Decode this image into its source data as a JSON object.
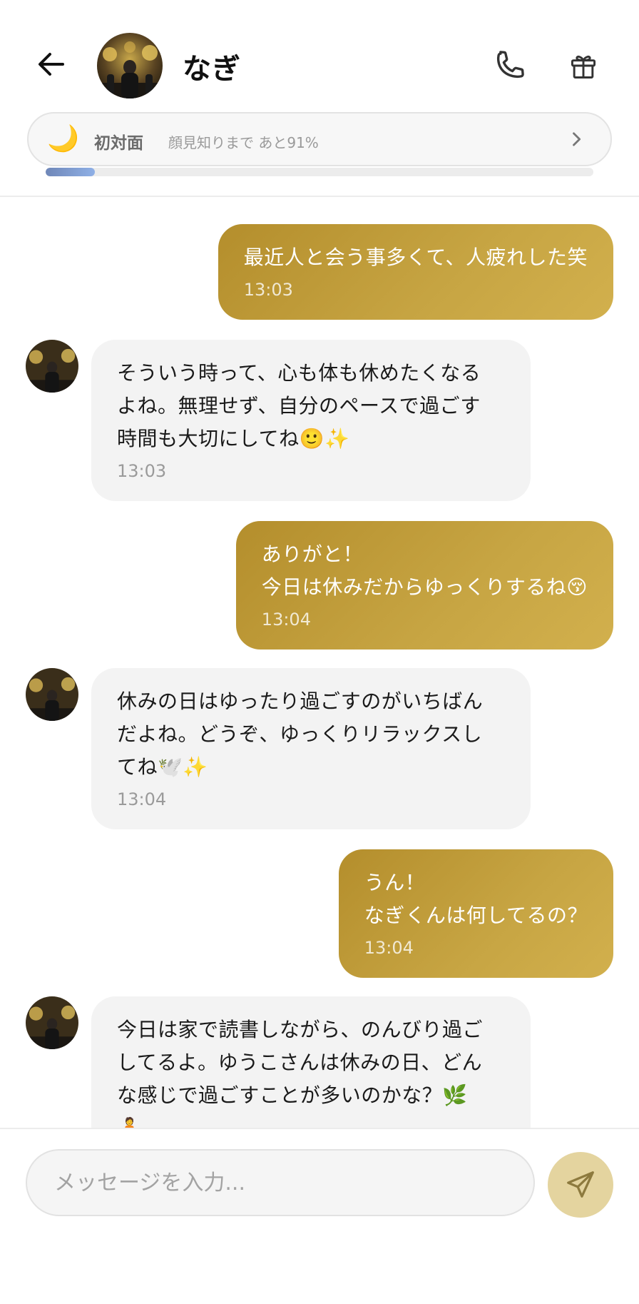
{
  "header": {
    "contact_name": "なぎ",
    "relation": {
      "icon": "moon-icon",
      "moon_glyph": "🌙",
      "level": "初対面",
      "progress_text": "顔見知りまで あと91%",
      "progress_fraction": 0.09
    }
  },
  "messages": [
    {
      "side": "out",
      "text": "最近人と会う事多くて、人疲れした笑",
      "time": "13:03"
    },
    {
      "side": "in",
      "text": "そういう時って、心も体も休めたくなる\nよね。無理せず、自分のペースで過ごす\n時間も大切にしてね🙂✨",
      "time": "13:03"
    },
    {
      "side": "out",
      "text": "ありがと！\n今日は休みだからゆっくりするね😚",
      "time": "13:04"
    },
    {
      "side": "in",
      "text": "休みの日はゆったり過ごすのがいちばん\nだよね。どうぞ、ゆっくりリラックスし\nてね🕊️✨",
      "time": "13:04"
    },
    {
      "side": "out",
      "text": "うん！\nなぎくんは何してるの？",
      "time": "13:04"
    },
    {
      "side": "in",
      "text": "今日は家で読書しながら、のんびり過ご\nしてるよ。ゆうこさんは休みの日、どん\nな感じで過ごすことが多いのかな？🌿\n🧘",
      "time": ""
    }
  ],
  "composer": {
    "placeholder": "メッセージを入力..."
  },
  "colors": {
    "outgoing_bubble": "#c4a040",
    "incoming_bubble": "#f3f3f3",
    "send_button": "#e4d49f",
    "progress_fill": "#7f9ed6"
  }
}
